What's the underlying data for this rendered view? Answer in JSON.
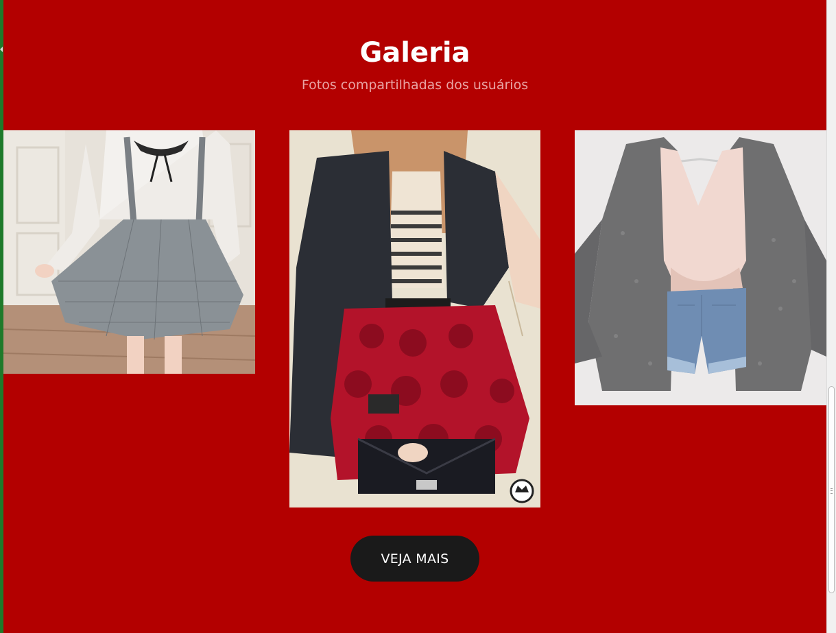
{
  "gallery": {
    "title": "Galeria",
    "subtitle": "Fotos compartilhadas dos usuários",
    "button_label": "VEJA MAIS"
  },
  "colors": {
    "section_background": "#b30000",
    "title": "#ffffff",
    "subtitle": "#e9a3a3",
    "button_background": "#1a1a1a",
    "button_text": "#ffffff"
  },
  "photos": [
    {
      "name": "photo-plaid-skirt-outfit"
    },
    {
      "name": "photo-leather-jacket-red-skirt-outfit"
    },
    {
      "name": "photo-cardigan-denim-shorts-outfit"
    }
  ]
}
